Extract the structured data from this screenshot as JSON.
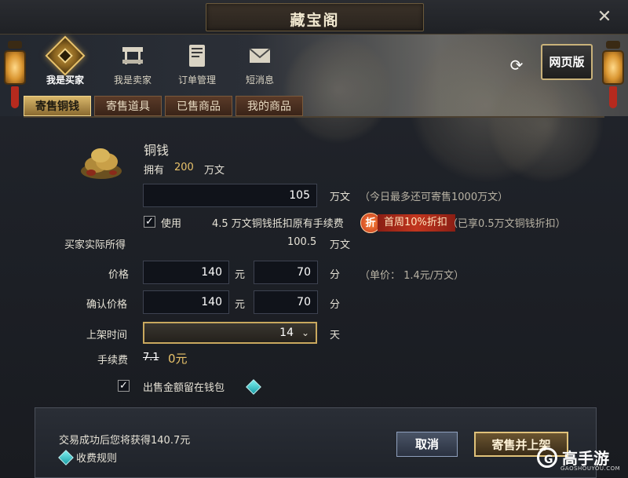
{
  "window": {
    "title": "藏宝阁",
    "close_glyph": "✕"
  },
  "nav": {
    "items": [
      {
        "label": "我是买家",
        "icon": "coin-diamond-icon",
        "active": true
      },
      {
        "label": "我是卖家",
        "icon": "market-stall-icon",
        "active": false
      },
      {
        "label": "订单管理",
        "icon": "book-icon",
        "active": false
      },
      {
        "label": "短消息",
        "icon": "envelope-icon",
        "active": false
      }
    ],
    "refresh_glyph": "⟳",
    "web_version_label": "网页版"
  },
  "tabs": [
    {
      "label": "寄售铜钱",
      "active": true
    },
    {
      "label": "寄售道具",
      "active": false
    },
    {
      "label": "已售商品",
      "active": false
    },
    {
      "label": "我的商品",
      "active": false
    }
  ],
  "item": {
    "name": "铜钱",
    "own_label": "拥有",
    "own_value": "200",
    "own_unit": "万文"
  },
  "form": {
    "amount_value": "105",
    "amount_unit": "万文",
    "amount_hint": "（今日最多还可寄售1000万文）",
    "use_label": "使用",
    "use_checked": true,
    "use_desc": "4.5 万文铜钱抵扣原有手续费",
    "discount_glyph": "折",
    "discount_text": "首周10%折扣",
    "discount_hint": "（已享0.5万文铜钱折扣）",
    "buyer_gets_label": "买家实际所得",
    "buyer_gets_value": "100.5",
    "buyer_gets_unit": "万文",
    "price_label": "价格",
    "price_yuan": "140",
    "price_yuan_unit": "元",
    "price_fen": "70",
    "price_fen_unit": "分",
    "unit_price_hint": "（单价：  1.4元/万文）",
    "confirm_label": "确认价格",
    "confirm_yuan": "140",
    "confirm_yuan_unit": "元",
    "confirm_fen": "70",
    "confirm_fen_unit": "分",
    "listing_label": "上架时间",
    "listing_value": "14",
    "listing_chev": "⌄",
    "listing_unit": "天",
    "fee_label": "手续费",
    "fee_old": "7.1",
    "fee_new": "0元",
    "keep_label": "出售金额留在钱包",
    "keep_checked": true
  },
  "footer": {
    "result_text": "交易成功后您将获得140.7元",
    "fee_rules_label": "收费规则",
    "cancel_label": "取消",
    "sell_label": "寄售并上架"
  },
  "watermark": {
    "name": "高手游",
    "url": "GAOSHOUYOU.COM",
    "logo_letter": "G"
  },
  "colors": {
    "accent_gold": "#e8c26a",
    "discount_red": "#c2361e",
    "bg": "#1c1f25"
  }
}
